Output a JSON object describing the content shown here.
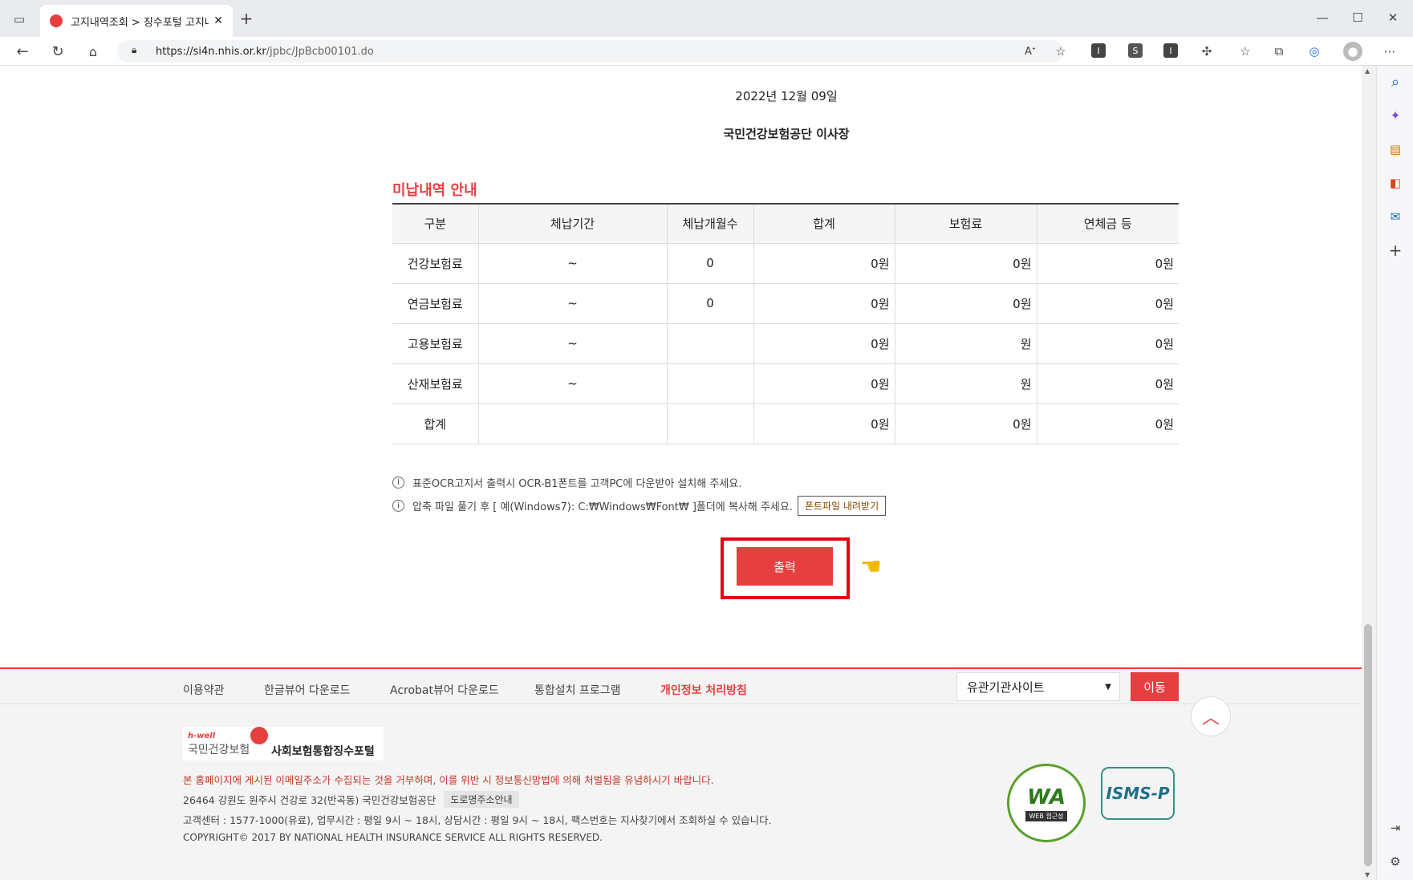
{
  "browser": {
    "tab_title": "고지내역조회 > 징수포털 고지내",
    "url": "https://si4n.nhis.or.kr/jpbc/JpBcb00101.do",
    "url_domain": "https://si4n.nhis.or.kr",
    "url_path": "/jpbc/JpBcb00101.do"
  },
  "doc": {
    "date": "2022년 12월 09일",
    "issuer": "국민건강보험공단 이사장"
  },
  "unpaid": {
    "title": "미납내역 안내",
    "headers": [
      "구분",
      "체납기간",
      "체납개월수",
      "합계",
      "보험료",
      "연체금 등"
    ],
    "rows": [
      [
        "건강보험료",
        "~",
        "0",
        "0원",
        "0원",
        "0원"
      ],
      [
        "연금보험료",
        "~",
        "0",
        "0원",
        "0원",
        "0원"
      ],
      [
        "고용보험료",
        "~",
        "",
        "0원",
        "원",
        "0원"
      ],
      [
        "산재보험료",
        "~",
        "",
        "0원",
        "원",
        "0원"
      ],
      [
        "합계",
        "",
        "",
        "0원",
        "0원",
        "0원"
      ]
    ]
  },
  "notes": {
    "note1": "표준OCR고지서 출력시 OCR-B1폰트를 고객PC에 다운받아 설치해 주세요.",
    "note2": "압축 파일 풀기 후 [ 예(Windows7): C:₩Windows₩Font₩ ]폴더에 복사해 주세요.",
    "font_download": "폰트파일 내려받기"
  },
  "print_button": "출력",
  "footer": {
    "links": [
      "이용약관",
      "한글뷰어 다운로드",
      "Acrobat뷰어 다운로드",
      "통합설치 프로그램",
      "개인정보 처리방침"
    ],
    "select_value": "유관기관사이트",
    "go_button": "이동",
    "logo_small": "h-well",
    "logo_org": "국민건강보험",
    "logo_portal": "사회보험통합징수포털",
    "warning": "본 홈페이지에 게시된 이메일주소가 수집되는 것을 거부하며, 이를 위반 시 정보통신망법에 의해 처벌됨을 유념하시기 바랍니다.",
    "address": "26464 강원도 원주시 건강로 32(반곡동) 국민건강보험공단",
    "road_btn": "도로명주소안내",
    "contact": "고객센터 : 1577-1000(유료), 업무시간 : 평일 9시 ~ 18시, 상담시간 : 평일 9시 ~ 18시, 팩스번호는 지사찾기에서 조회하실 수 있습니다.",
    "copyright": "COPYRIGHT© 2017 BY NATIONAL HEALTH INSURANCE SERVICE ALL RIGHTS RESERVED.",
    "wa_text": "WA",
    "wa_sub": "WEB 접근성",
    "isms_text": "ISMS-P"
  },
  "colors": {
    "accent": "#e63f3f",
    "highlight_box": "#e60012"
  }
}
